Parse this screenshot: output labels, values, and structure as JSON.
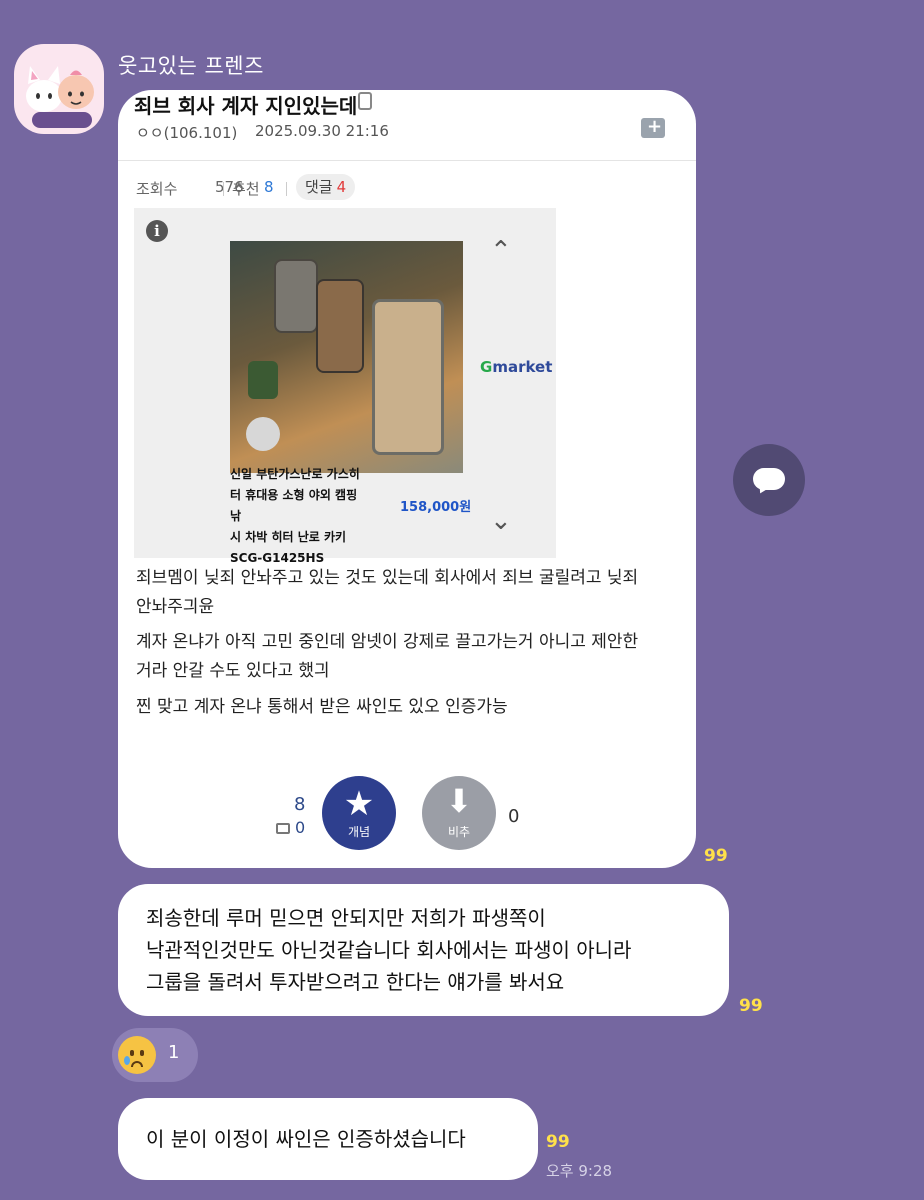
{
  "chat": {
    "sender_name": "웃고있는 프렌즈",
    "time": "오후 9:28"
  },
  "image_message": {
    "post_title": "죄브 회사 계자 지인있는데",
    "author": "ㅇㅇ(106.101)",
    "date": "2025.09.30 21:16",
    "views_label": "조회수",
    "views_value": "576",
    "recommend_label": "추천",
    "recommend_value": "8",
    "comments_label": "댓글",
    "comments_value": "4",
    "ad": {
      "brand": "Gmarket",
      "product_name_lines": [
        "신일 부탄가스난로 가스히",
        "터 휴대용 소형 야외 캠핑 낚",
        "시 차박 히터 난로 카키",
        "SCG-G1425HS"
      ],
      "price": "158,000원"
    },
    "body_lines": [
      "죄브멤이 닞죄 안놔주고 있는 것도 있는데 회사에서 죄브 굴릴려고 닞죄",
      "안놔주긔윤",
      "계자 온냐가 아직 고민 중인데 암넷이 강제로 끌고가는거 아니고 제안한",
      "거라 안갈 수도 있다고 했긔",
      "찐 맞고 계자 온냐 통해서 받은 싸인도 있오 인증가능"
    ],
    "vote_up_count": "8",
    "comment_count": "0",
    "vote_up_label": "개념",
    "vote_down_label": "비추",
    "vote_down_count": "0",
    "unread": "99"
  },
  "message_2": {
    "lines": [
      "죄송한데 루머 믿으면 안되지만 저희가 파생쪽이",
      "낙관적인것만도 아닌것같습니다 회사에서는 파생이 아니라",
      "그룹을 돌려서 투자받으려고 한다는 얘가를 봐서요"
    ],
    "unread": "99",
    "reaction_count": "1"
  },
  "message_3": {
    "text": "이 분이 이정이 싸인은 인증하셨습니다",
    "unread": "99"
  },
  "colors": {
    "background": "#7567a0",
    "unread": "#ffe14a",
    "vote_up": "#2e3f8e"
  }
}
